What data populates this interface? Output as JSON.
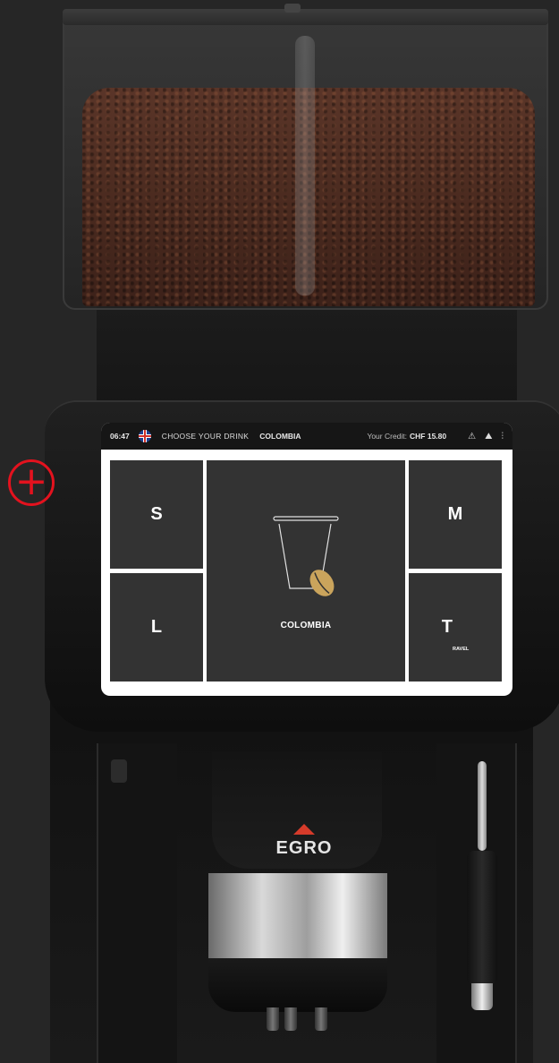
{
  "status_bar": {
    "time": "06:47",
    "title": "CHOOSE YOUR DRINK",
    "product": "COLOMBIA",
    "credit_label": "Your Credit:",
    "credit_value": "CHF 15.80",
    "icons": [
      "warning-icon",
      "service-icon",
      "settings-icon"
    ]
  },
  "sizes": {
    "small": "S",
    "medium": "M",
    "large": "L",
    "travel": "T",
    "travel_sub": "RAVEL"
  },
  "drink": {
    "name": "COLOMBIA"
  },
  "brand": {
    "logo_text": "EGRO",
    "accent": "#d63b2a"
  },
  "marker": {
    "symbol": "+",
    "color": "#e3121e"
  }
}
